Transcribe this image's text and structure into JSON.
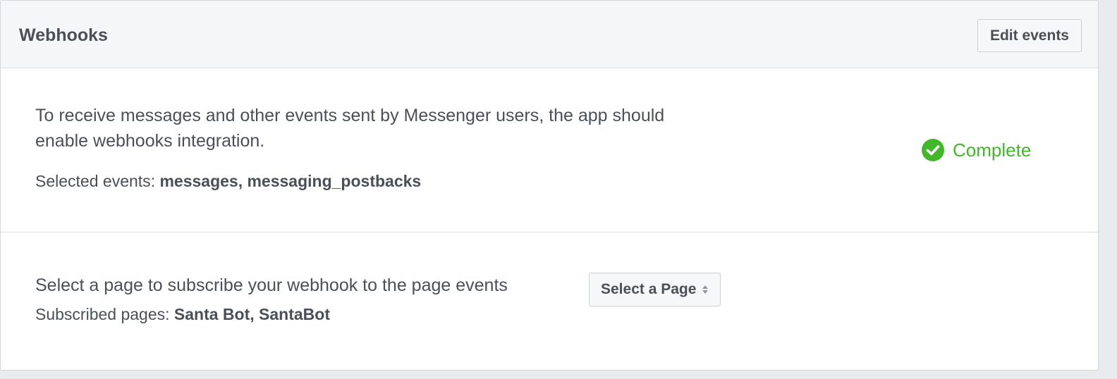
{
  "header": {
    "title": "Webhooks",
    "edit_button_label": "Edit events"
  },
  "webhooks_section": {
    "description": "To receive messages and other events sent by Messenger users, the app should enable webhooks integration.",
    "selected_events_label": "Selected events:",
    "selected_events_value": "messages, messaging_postbacks",
    "status": {
      "icon": "check-circle-icon",
      "label": "Complete",
      "color": "#42b72a"
    }
  },
  "subscribe_section": {
    "prompt": "Select a page to subscribe your webhook to the page events",
    "subscribed_pages_label": "Subscribed pages:",
    "subscribed_pages_value": "Santa Bot, SantaBot",
    "select": {
      "selected_value": "Select a Page",
      "icon": "sort-arrows-icon"
    }
  },
  "colors": {
    "header_background": "#f5f6f7",
    "text": "#4b4f56",
    "success": "#42b72a",
    "border": "#dddfe2"
  }
}
